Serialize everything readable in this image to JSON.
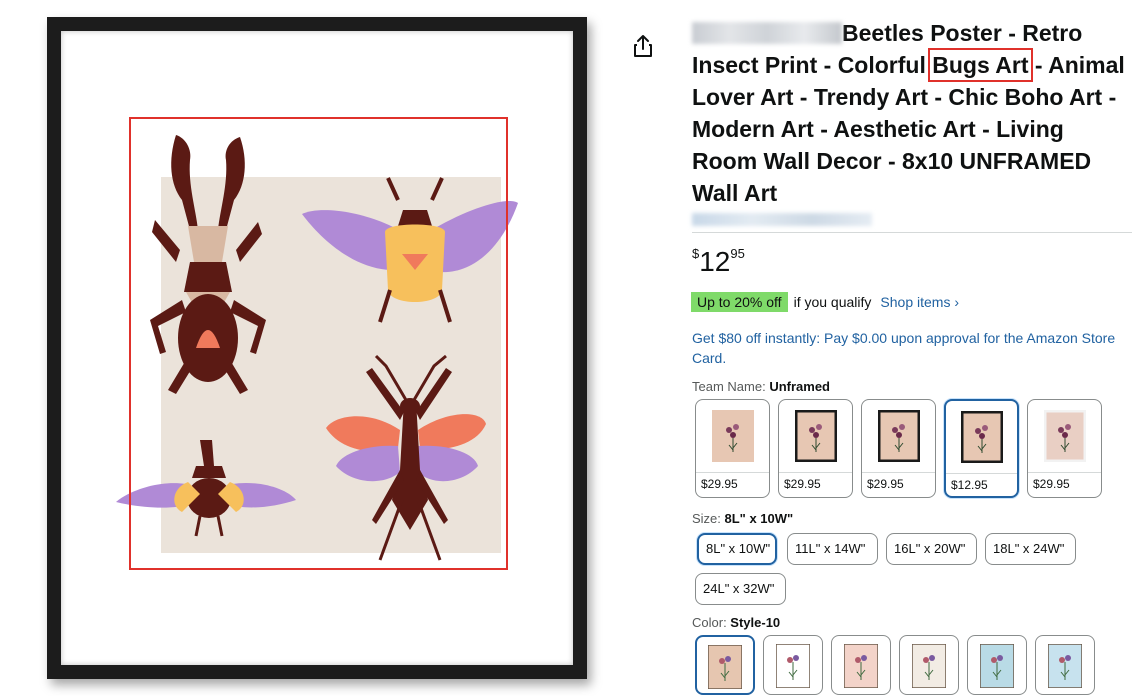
{
  "product": {
    "title_redacted_lead": "",
    "title_part1": "Beetles Poster - Retro Insect Print - Colorful ",
    "title_highlight": "Bugs Art",
    "title_part2": " - Animal Lover Art - Trendy Art - Chic Boho Art - Modern Art - Aesthetic Art - Living Room Wall Decor - 8x10 UNFRAMED Wall Art"
  },
  "price": {
    "symbol": "$",
    "whole": "12",
    "fraction": "95"
  },
  "deal": {
    "badge": "Up to 20% off",
    "text": "if you qualify",
    "link": "Shop items ›"
  },
  "card_offer": "Get $80 off instantly: Pay $0.00 upon approval for the Amazon Store Card.",
  "team_name": {
    "label": "Team Name: ",
    "value": "Unframed",
    "options": [
      {
        "price": "$29.95",
        "frame": "none",
        "mat": "#e7c7b3"
      },
      {
        "price": "$29.95",
        "frame": "#1a1a1a",
        "mat": "#e7c7b3"
      },
      {
        "price": "$29.95",
        "frame": "#1a1a1a",
        "mat": "#e7c7b3"
      },
      {
        "price": "$12.95",
        "frame": "#1a1a1a",
        "mat": "#e7c7b3",
        "selected": true
      },
      {
        "price": "$29.95",
        "frame": "#f2f2f2",
        "mat": "#e9cfc4"
      }
    ]
  },
  "size": {
    "label": "Size: ",
    "value": "8L\" x 10W\"",
    "options": [
      "8L\" x 10W\"",
      "11L\" x 14W\"",
      "16L\" x 20W\"",
      "18L\" x 24W\"",
      "24L\" x 32W\""
    ]
  },
  "color": {
    "label": "Color: ",
    "value": "Style-10",
    "options": [
      {
        "bg": "#e6c6b0",
        "selected": true
      },
      {
        "bg": "#ffffff"
      },
      {
        "bg": "#f3d3c9"
      },
      {
        "bg": "#f2ece4"
      },
      {
        "bg": "#b9dbe6"
      },
      {
        "bg": "#c7e2ee"
      }
    ]
  },
  "colors": {
    "link": "#2162a1",
    "deal": "#7fda69",
    "highlight": "#e0312b"
  },
  "icons": {
    "share": "share-icon"
  }
}
